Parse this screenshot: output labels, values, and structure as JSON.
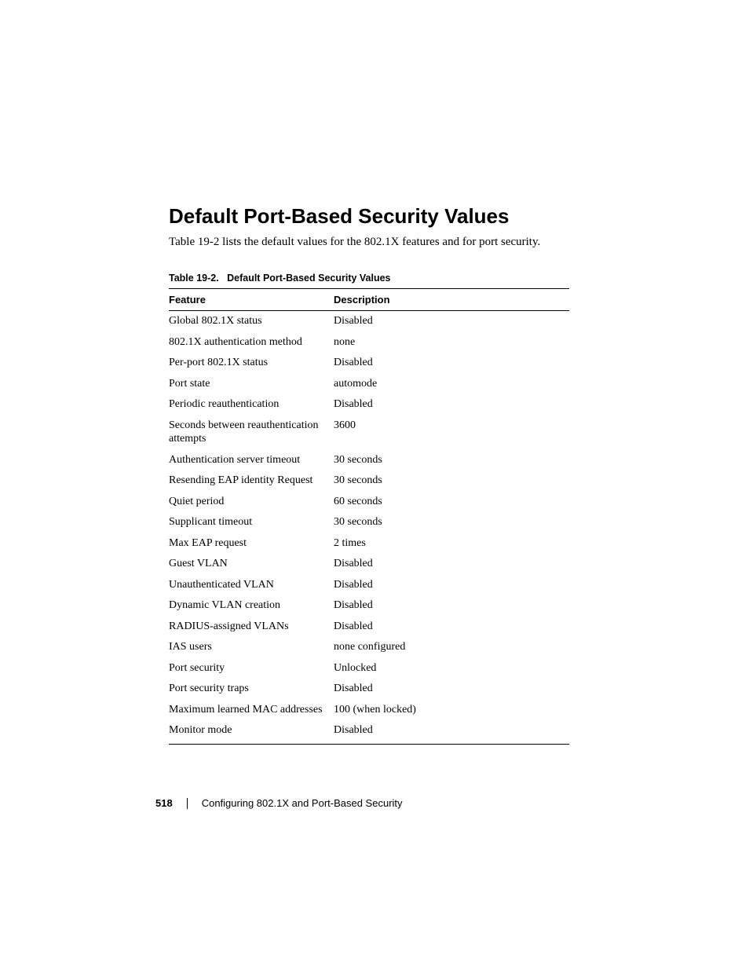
{
  "heading": "Default Port-Based Security Values",
  "intro": "Table 19-2 lists the default values for the 802.1X features and for port security.",
  "table": {
    "caption_prefix": "Table 19-2.",
    "caption_title": "Default Port-Based Security Values",
    "columns": {
      "feature": "Feature",
      "description": "Description"
    },
    "rows": [
      {
        "feature": "Global 802.1X status",
        "description": "Disabled"
      },
      {
        "feature": "802.1X authentication method",
        "description": "none"
      },
      {
        "feature": "Per-port 802.1X status",
        "description": "Disabled"
      },
      {
        "feature": "Port state",
        "description": "automode"
      },
      {
        "feature": "Periodic reauthentication",
        "description": "Disabled"
      },
      {
        "feature": "Seconds between reauthentication attempts",
        "description": "3600"
      },
      {
        "feature": "Authentication server timeout",
        "description": "30 seconds"
      },
      {
        "feature": "Resending EAP identity Request",
        "description": "30 seconds"
      },
      {
        "feature": "Quiet period",
        "description": "60 seconds"
      },
      {
        "feature": "Supplicant timeout",
        "description": "30 seconds"
      },
      {
        "feature": "Max EAP request",
        "description": "2 times"
      },
      {
        "feature": "Guest VLAN",
        "description": "Disabled"
      },
      {
        "feature": "Unauthenticated VLAN",
        "description": "Disabled"
      },
      {
        "feature": "Dynamic VLAN creation",
        "description": "Disabled"
      },
      {
        "feature": "RADIUS-assigned VLANs",
        "description": "Disabled"
      },
      {
        "feature": "IAS users",
        "description": "none configured"
      },
      {
        "feature": "Port security",
        "description": "Unlocked"
      },
      {
        "feature": "Port security traps",
        "description": "Disabled"
      },
      {
        "feature": "Maximum learned MAC addresses",
        "description": "100 (when locked)"
      },
      {
        "feature": "Monitor mode",
        "description": "Disabled"
      }
    ]
  },
  "footer": {
    "page_number": "518",
    "chapter": "Configuring 802.1X and Port-Based Security"
  }
}
